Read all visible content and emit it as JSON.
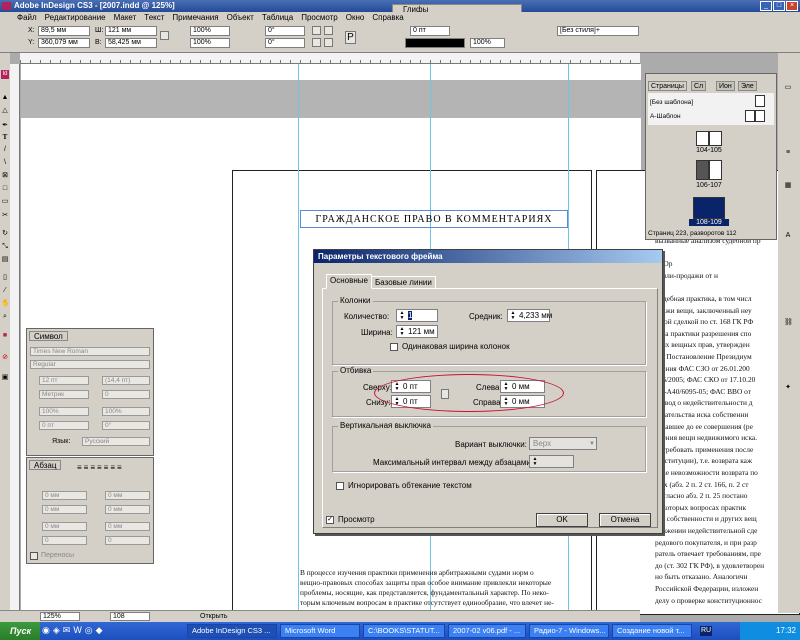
{
  "app": {
    "title": "Adobe InDesign CS3 - [2007.indd @ 125%]",
    "menu": [
      "Файл",
      "Редактирование",
      "Макет",
      "Текст",
      "Примечания",
      "Объект",
      "Таблица",
      "Просмотр",
      "Окно",
      "Справка"
    ],
    "glyph_panel": "Глифы"
  },
  "control": {
    "x": "89,5 мм",
    "y": "360,079 мм",
    "w": "121 мм",
    "h": "58,425 мм",
    "scale_x": "100%",
    "scale_y": "100%",
    "angle": "0°",
    "shear": "0°",
    "stroke": "0 пт",
    "opacity": "100%",
    "style": "[Без стиля]+"
  },
  "document": {
    "heading": "ГРАЖДАНСКОЕ ПРАВО В КОММЕНТАРИЯХ",
    "bottom_text": [
      "В процессе изучения практики применения арбитражными судами норм о",
      "вещно-правовых способах защиты прав особое внимание привлекли некоторые",
      "проблемы, носящие, как представляется, фундаментальный характер. По неко-",
      "торым ключевым вопросам в практике отсутствует единообразие, что влечет не-"
    ],
    "right_text": [
      "вызванные анализом судебной пр",
      "",
      "I. Юр",
      "купли-продажи от н",
      "",
      "Судебная практика, в том числ",
      "одажи вещи, заключенный неу",
      "жной сделкой по ст. 168 ГК РФ",
      "зора практики разрешения спо",
      "угих вещных прав, утвержден",
      "13; Постановление Президиум",
      "вления ФАС СЗО от 26.01.200",
      "596/2005; ФАС СКО от 17.10.20",
      "КГ-А40/6095-05; ФАС ВВО от",
      "Вывод о недействительности д",
      "зовательства иска собственни",
      "ковавшее до ее совершения (ре",
      "орения вещи недвижимого иска.",
      "потребовать применения после",
      "(реституции), т.е. возврата каж",
      "учае невозможности возврата по",
      "ных (абз. 2 п. 2 ст. 166, п. 2 ст",
      "Согласно абз. 2 п. 25 постано",
      "некоторых вопросах практик",
      "ава собственности и других вещ",
      "пражении недействительной сде",
      "редового покупателя, и при разр",
      "ратель отвечает требованиям, пре",
      "до (ст. 302 ГК РФ), в удовлетворен",
      "но быть отказано. Аналогичн",
      "Российской Федерации, изложен",
      "делу о проверке конституционнос"
    ]
  },
  "dialog": {
    "title": "Параметры текстового фрейма",
    "tabs": [
      "Основные",
      "Базовые линии"
    ],
    "columns_group": "Колонки",
    "count_label": "Количество:",
    "count_value": "1",
    "gutter_label": "Средник:",
    "gutter_value": "4,233 мм",
    "width_label": "Ширина:",
    "width_value": "121 мм",
    "fixed_width_label": "Одинаковая ширина колонок",
    "inset_group": "Отбивка",
    "top_label": "Сверху:",
    "top_value": "0 пт",
    "bottom_label": "Снизу:",
    "bottom_value": "0 пт",
    "left_label": "Слева:",
    "left_value": "0 мм",
    "right_label": "Справа:",
    "right_value": "0 мм",
    "vjust_group": "Вертикальная выключка",
    "align_label": "Вариант выключки:",
    "align_value": "Верх",
    "para_spacing_label": "Максимальный интервал между абзацами:",
    "ignore_wrap_label": "Игнорировать обтекание текстом",
    "preview_label": "Просмотр",
    "ok": "OK",
    "cancel": "Отмена"
  },
  "pages_panel": {
    "tabs": [
      "Страницы",
      "Сл",
      "Ион",
      "Эле"
    ],
    "none_master": "[Без шаблона]",
    "a_master": "А-Шаблон",
    "spreads": [
      "104-105",
      "106-107",
      "108-109"
    ],
    "footer": "Страниц 223, разворотов 112"
  },
  "char_panel": {
    "tab": "Символ",
    "font": "Times New Roman",
    "style": "Regular",
    "size": "12 пт",
    "leading": "(14,4 пт)",
    "kerning": "Метрик",
    "tracking": "0",
    "vscale": "100%",
    "hscale": "100%",
    "baseline": "0 пт",
    "skew": "0°",
    "lang_label": "Язык:",
    "lang": "Русский"
  },
  "para_panel": {
    "tab": "Абзац",
    "f1": "0 мм",
    "f2": "0 мм",
    "f3": "0 мм",
    "f4": "0 мм",
    "f5": "0 мм",
    "f6": "0 мм",
    "f7": "0",
    "f8": "0",
    "hyphenate": "Переносы"
  },
  "status": {
    "zoom": "125%",
    "page": "108",
    "state": "Открыть"
  },
  "taskbar": {
    "start": "Пуск",
    "items": [
      "Adobe InDesign CS3 ...",
      "Microsoft Word",
      "C:\\BOOKS\\STATUT...",
      "2007-02 v06.pdf - ...",
      "Радио-7 - Windows...",
      "Создание новой т..."
    ],
    "lang": "RU",
    "clock": "17:32"
  }
}
